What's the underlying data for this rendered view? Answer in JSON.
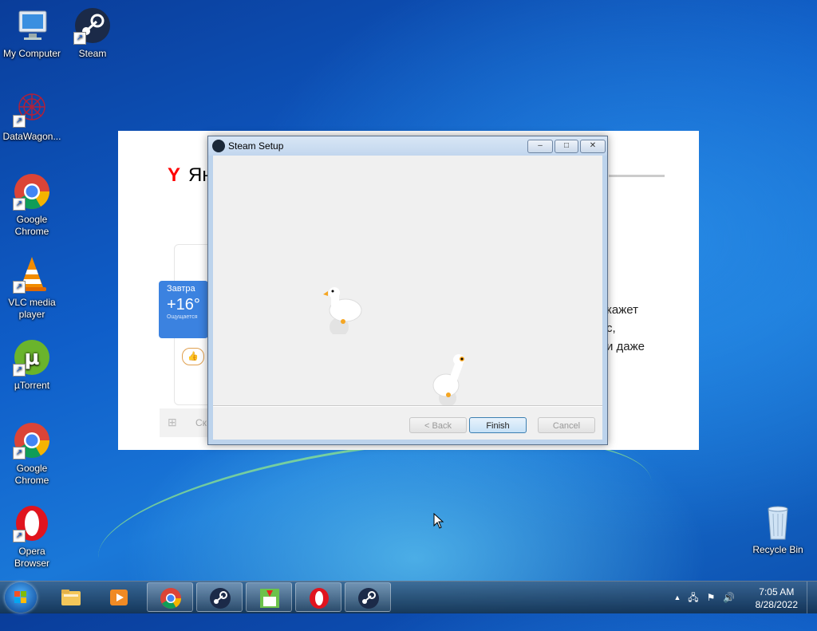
{
  "desktop": {
    "icons": [
      {
        "label": "My Computer",
        "icon": "computer-icon"
      },
      {
        "label": "Steam",
        "icon": "steam-icon"
      },
      {
        "label": "DataWagon...",
        "icon": "datawagon-icon"
      },
      {
        "label": "Google Chrome",
        "icon": "chrome-icon"
      },
      {
        "label": "VLC media player",
        "icon": "vlc-icon"
      },
      {
        "label": "µTorrent",
        "icon": "utorrent-icon"
      },
      {
        "label": "Google Chrome",
        "icon": "chrome-icon"
      },
      {
        "label": "Opera Browser",
        "icon": "opera-icon"
      },
      {
        "label": "Recycle Bin",
        "icon": "recycle-bin-icon"
      }
    ]
  },
  "background_window": {
    "logo_letter": "Y",
    "logo_text": "Ян",
    "weather": {
      "label": "Завтра",
      "temp": "+16°",
      "feels": "Ощущается"
    },
    "text_lines": [
      "кажет",
      "с,",
      "и даже"
    ],
    "search_placeholder": "Ск",
    "emoji": "👍"
  },
  "dialog": {
    "title": "Steam Setup",
    "buttons": {
      "back": "< Back",
      "finish": "Finish",
      "cancel": "Cancel"
    },
    "controls": {
      "minimize": "–",
      "maximize": "□",
      "close": "✕"
    }
  },
  "taskbar": {
    "pinned": [
      {
        "name": "explorer",
        "icon": "folder-icon"
      },
      {
        "name": "media-player",
        "icon": "media-player-icon"
      },
      {
        "name": "chrome",
        "icon": "chrome-icon"
      },
      {
        "name": "steam",
        "icon": "steam-icon"
      },
      {
        "name": "yandex-installer",
        "icon": "installer-icon"
      },
      {
        "name": "opera",
        "icon": "opera-icon"
      },
      {
        "name": "steam-setup",
        "icon": "steam-icon"
      }
    ],
    "clock": {
      "time": "7:05 AM",
      "date": "8/28/2022"
    },
    "tray_expand": "▲"
  }
}
